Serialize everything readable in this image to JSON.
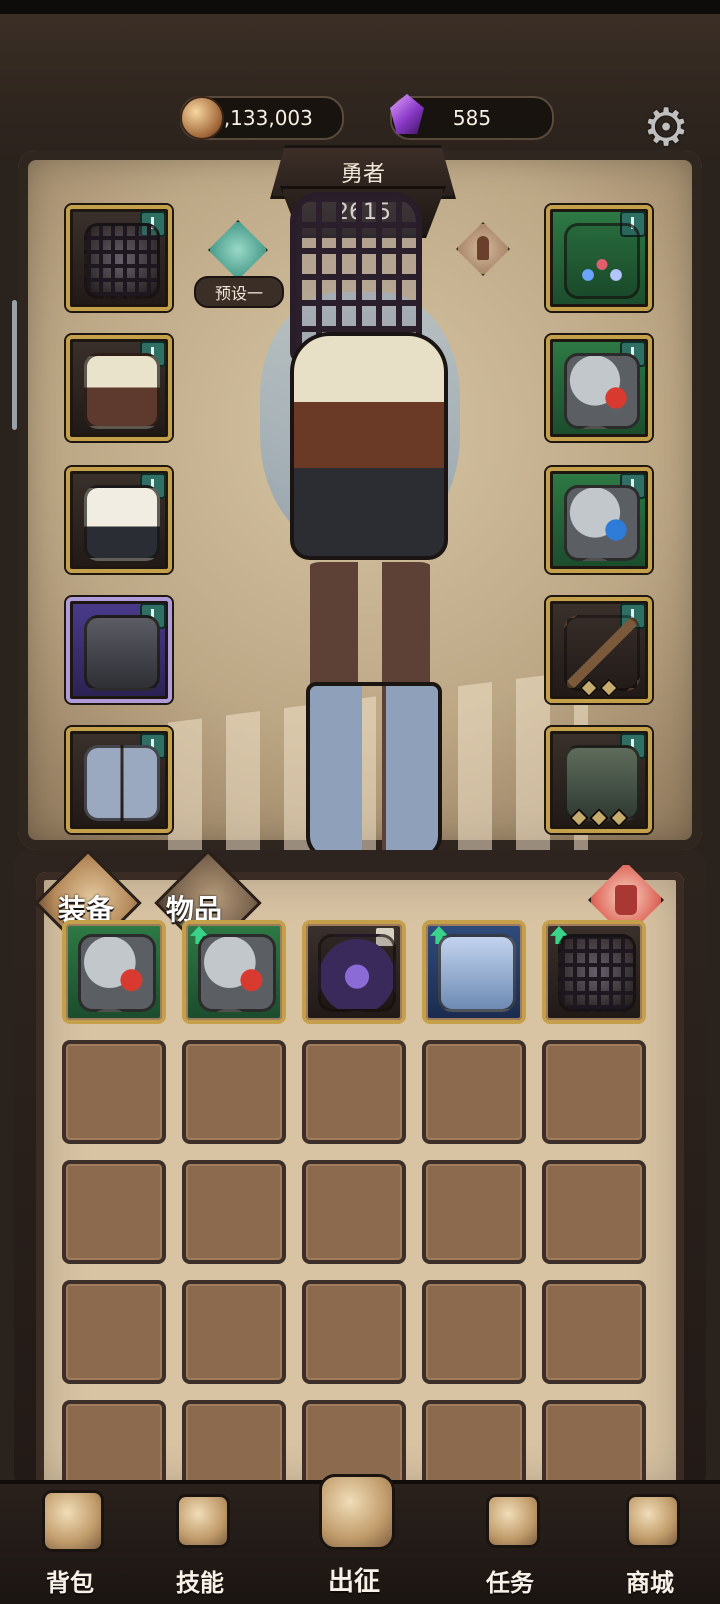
{
  "currency": {
    "gold_amount": "5,133,003",
    "gem_amount": "585"
  },
  "hero": {
    "title": "勇者",
    "power": "2615",
    "preset_label": "预设一"
  },
  "tabs": {
    "equipment": "装备",
    "items": "物品"
  },
  "bottom_nav": [
    {
      "label": "背包",
      "icon": "backpack-icon"
    },
    {
      "label": "技能",
      "icon": "skill-book-icon"
    },
    {
      "label": "出征",
      "icon": "banner-icon"
    },
    {
      "label": "任务",
      "icon": "scroll-icon"
    },
    {
      "label": "商城",
      "icon": "shop-icon"
    }
  ],
  "icons": {
    "settings": "gear-icon",
    "trash": "trash-icon"
  },
  "colors": {
    "background": "#2a221c",
    "gold_frame": "#c5a04a",
    "green_rarity": "#2e7a45",
    "purple_rarity": "#4a3b8c",
    "inventory_cell": "#8b6a4e"
  }
}
